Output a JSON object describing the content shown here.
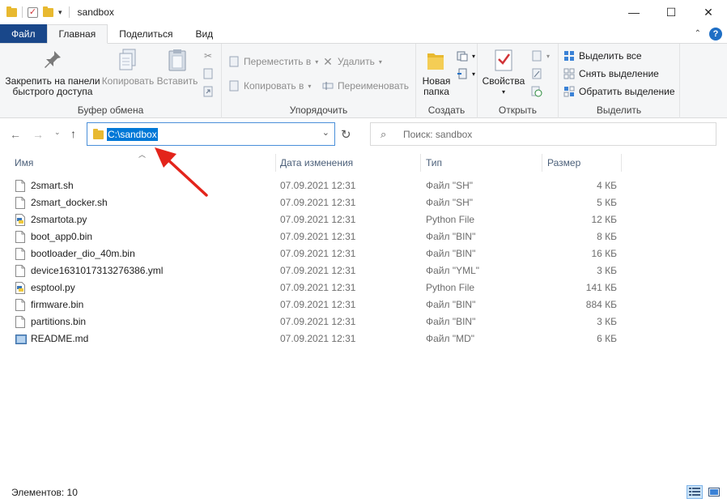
{
  "window": {
    "title": "sandbox",
    "minimize_glyph": "—",
    "maximize_glyph": "☐",
    "close_glyph": "✕"
  },
  "quick_access": {
    "dropdown_glyph": "▾"
  },
  "tabs": [
    {
      "label": "Файл"
    },
    {
      "label": "Главная"
    },
    {
      "label": "Поделиться"
    },
    {
      "label": "Вид"
    }
  ],
  "ribbon": {
    "clipboard": {
      "label": "Буфер обмена",
      "pin": "Закрепить на панели быстрого доступа",
      "pin_line1": "Закрепить на панели",
      "pin_line2": "быстрого доступа",
      "copy": "Копировать",
      "paste": "Вставить"
    },
    "organize": {
      "label": "Упорядочить",
      "move_to": "Переместить в",
      "copy_to": "Копировать в",
      "delete": "Удалить",
      "rename": "Переименовать"
    },
    "new": {
      "label": "Создать",
      "new_folder_line1": "Новая",
      "new_folder_line2": "папка"
    },
    "open": {
      "label": "Открыть",
      "properties": "Свойства"
    },
    "select": {
      "label": "Выделить",
      "select_all": "Выделить все",
      "select_none": "Снять выделение",
      "invert": "Обратить выделение"
    }
  },
  "address": {
    "path": "C:\\sandbox",
    "search_placeholder": "Поиск: sandbox"
  },
  "columns": {
    "name": "Имя",
    "date": "Дата изменения",
    "type": "Тип",
    "size": "Размер"
  },
  "files": [
    {
      "name": "2smart.sh",
      "date": "07.09.2021 12:31",
      "type": "Файл \"SH\"",
      "size": "4 КБ",
      "icon": "file-icon"
    },
    {
      "name": "2smart_docker.sh",
      "date": "07.09.2021 12:31",
      "type": "Файл \"SH\"",
      "size": "5 КБ",
      "icon": "file-icon"
    },
    {
      "name": "2smartota.py",
      "date": "07.09.2021 12:31",
      "type": "Python File",
      "size": "12 КБ",
      "icon": "python-file-icon"
    },
    {
      "name": "boot_app0.bin",
      "date": "07.09.2021 12:31",
      "type": "Файл \"BIN\"",
      "size": "8 КБ",
      "icon": "file-icon"
    },
    {
      "name": "bootloader_dio_40m.bin",
      "date": "07.09.2021 12:31",
      "type": "Файл \"BIN\"",
      "size": "16 КБ",
      "icon": "file-icon"
    },
    {
      "name": "device1631017313276386.yml",
      "date": "07.09.2021 12:31",
      "type": "Файл \"YML\"",
      "size": "3 КБ",
      "icon": "file-icon"
    },
    {
      "name": "esptool.py",
      "date": "07.09.2021 12:31",
      "type": "Python File",
      "size": "141 КБ",
      "icon": "python-file-icon"
    },
    {
      "name": "firmware.bin",
      "date": "07.09.2021 12:31",
      "type": "Файл \"BIN\"",
      "size": "884 КБ",
      "icon": "file-icon"
    },
    {
      "name": "partitions.bin",
      "date": "07.09.2021 12:31",
      "type": "Файл \"BIN\"",
      "size": "3 КБ",
      "icon": "file-icon"
    },
    {
      "name": "README.md",
      "date": "07.09.2021 12:31",
      "type": "Файл \"MD\"",
      "size": "6 КБ",
      "icon": "markdown-file-icon"
    }
  ],
  "status": {
    "items_count": "Элементов: 10"
  },
  "colors": {
    "file_tab": "#19478a",
    "selection": "#0078d7",
    "annotation_arrow": "#e3241b"
  }
}
